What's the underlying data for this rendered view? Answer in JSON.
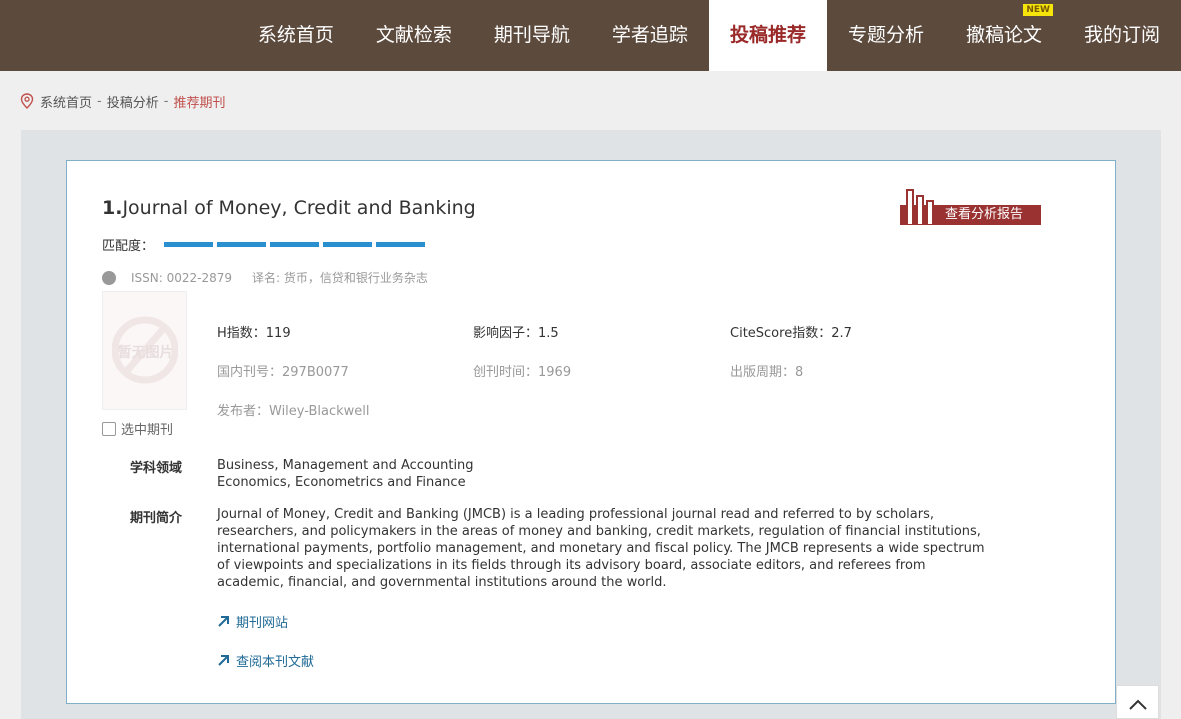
{
  "nav": {
    "items": [
      {
        "label": "系统首页"
      },
      {
        "label": "文献检索"
      },
      {
        "label": "期刊导航"
      },
      {
        "label": "学者追踪"
      },
      {
        "label": "投稿推荐",
        "active": true
      },
      {
        "label": "专题分析"
      },
      {
        "label": "撤稿论文",
        "badge": "NEW"
      },
      {
        "label": "我的订阅"
      }
    ]
  },
  "breadcrumb": {
    "home": "系统首页",
    "sep": "-",
    "parent": "投稿分析",
    "current": "推荐期刊"
  },
  "journal": {
    "index": "1.",
    "name": "Journal of Money, Credit and Banking",
    "report_button": "查看分析报告",
    "match_label": "匹配度：",
    "match_level": 5,
    "match_max": 5,
    "issn": "ISSN: 0022-2879",
    "translated_name": "译名: 货币，信贷和银行业务杂志",
    "cover_placeholder": "暂无图片",
    "select_label": "选中期刊",
    "h_index": "H指数：119",
    "impact_factor": "影响因子：1.5",
    "citescore": "CiteScore指数：2.7",
    "domestic_code": "国内刊号：297B0077",
    "founded": "创刊时间：1969",
    "period": "出版周期：8",
    "publisher": "发布者：Wiley-Blackwell",
    "subject_label": "学科领域",
    "subjects": [
      "Business, Management and Accounting",
      "Economics, Econometrics and Finance"
    ],
    "intro_label": "期刊简介",
    "intro": "Journal of Money, Credit and Banking (JMCB) is a leading professional journal read and referred to by scholars, researchers, and policymakers in the areas of money and banking, credit markets, regulation of financial institutions, international payments, portfolio management, and monetary and fiscal policy. The JMCB represents a wide spectrum of viewpoints and specializations in its fields through its advisory board, associate editors, and referees from academic, financial, and governmental institutions around the world.",
    "website_link": "期刊网站",
    "articles_link": "查阅本刊文献"
  },
  "colors": {
    "header_bg": "#5c4a3d",
    "active_nav_text": "#9a2a2a",
    "report_button_bg": "#9a3232",
    "match_bar": "#2a8fcf",
    "link": "#1f6a96"
  }
}
